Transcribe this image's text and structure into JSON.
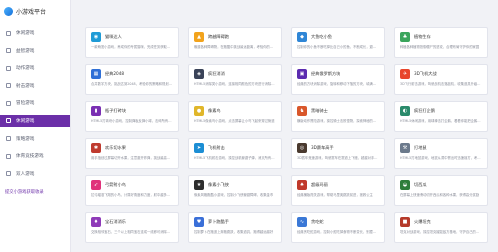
{
  "app": {
    "title": "小游戏平台"
  },
  "sidebar": {
    "items": [
      {
        "label": "休闲游戏",
        "icon": "gamepad-icon",
        "active": false
      },
      {
        "label": "益智游戏",
        "icon": "puzzle-icon",
        "active": false
      },
      {
        "label": "动作游戏",
        "icon": "action-icon",
        "active": false
      },
      {
        "label": "射击游戏",
        "icon": "target-icon",
        "active": false
      },
      {
        "label": "冒险游戏",
        "icon": "compass-icon",
        "active": false
      },
      {
        "label": "休闲游戏",
        "icon": "gamepad-icon",
        "active": true
      },
      {
        "label": "策略游戏",
        "icon": "strategy-icon",
        "active": false
      },
      {
        "label": "体育竞技游戏",
        "icon": "trophy-icon",
        "active": false
      },
      {
        "label": "双人游戏",
        "icon": "users-icon",
        "active": false
      }
    ],
    "footer_link": "提交小游戏获取收录"
  },
  "games": [
    {
      "name": "猫咪达人",
      "desc": "一款萌宠小游戏，养成你的专属猫咪，完成任务获取奖励",
      "color": "#1f9bd6",
      "icon": "cat-icon",
      "glyph": "◉"
    },
    {
      "name": "跨越障碍跑",
      "desc": "躲避各种障碍物，在跑酷中挑战最远距离，考验你的反应速度",
      "color": "#f2a31c",
      "icon": "runner-icon",
      "glyph": "▲"
    },
    {
      "name": "大鱼吃小鱼",
      "desc": "控制你的小鱼不断吃掉比自己小的鱼，不断成长，避开大鱼",
      "color": "#2f86d6",
      "icon": "fish-icon",
      "glyph": "◆"
    },
    {
      "name": "植物生存",
      "desc": "种植各种植物抵御僵尸的进攻，合理布局守护你的家园",
      "color": "#3aa55c",
      "icon": "plant-icon",
      "glyph": "♣"
    },
    {
      "name": "经典2048",
      "desc": "合并数字方块，挑战达到2048，考验你的策略和规划能力",
      "color": "#2f6fd6",
      "icon": "tiles-icon",
      "glyph": "▦"
    },
    {
      "name": "疯狂消消",
      "desc": "HTML5消除类小游戏，连接相同颜色的方块进行消除得分",
      "color": "#3a4358",
      "icon": "gem-icon",
      "glyph": "◈"
    },
    {
      "name": "经典俄罗斯方块",
      "desc": "经典的方块消除游戏，旋转和移动下落的方块，填满整行消除",
      "color": "#5b2bb0",
      "icon": "blocks-icon",
      "glyph": "▣"
    },
    {
      "name": "3D飞机大战",
      "desc": "3D飞行射击游戏，驾驶战机击落敌机，收集道具升级武器",
      "color": "#e8452c",
      "icon": "plane-icon",
      "glyph": "✈"
    },
    {
      "name": "瓶子打砖块",
      "desc": "HTML5打砖块小游戏，控制弹板反弹小球，击碎所有砖块过关",
      "color": "#7a2fb3",
      "icon": "bottle-icon",
      "glyph": "▮"
    },
    {
      "name": "像素鸟",
      "desc": "HTML5像素鸟小游戏，点击屏幕让小鸟飞起来穿过管道",
      "color": "#e0b62a",
      "icon": "bird-icon",
      "glyph": "●"
    },
    {
      "name": "黑暗骑士",
      "desc": "横版动作冒险游戏，操控骑士击败怪物，探索神秘的城堡",
      "color": "#d9572b",
      "icon": "knight-icon",
      "glyph": "♞"
    },
    {
      "name": "疯狂打企鹅",
      "desc": "HTML5休闲游戏，用球棒击打企鹅，看看你能把企鹅打多远",
      "color": "#2a8a6b",
      "icon": "penguin-icon",
      "glyph": "◐"
    },
    {
      "name": "欢乐切水果",
      "desc": "用手指划过屏幕切开水果，注意避开炸弹，挑战最高连击分数",
      "color": "#bf3b2f",
      "icon": "fruit-icon",
      "glyph": "✱"
    },
    {
      "name": "飞机射击",
      "desc": "HTML5飞机射击游戏，操控战机躲避子弹，消灭所有敌机",
      "color": "#1c8ed4",
      "icon": "jet-icon",
      "glyph": "➤"
    },
    {
      "name": "3D赛车高手",
      "desc": "3D赛车竞速游戏，驾驶赛车在赛道上飞驰，超越对手夺冠",
      "color": "#4a3a2f",
      "icon": "car-icon",
      "glyph": "◎"
    },
    {
      "name": "打地鼠",
      "desc": "HTML5打地鼠游戏，地鼠从洞中冒出时迅速敲打，考验手速",
      "color": "#6c7a8c",
      "icon": "hammer-icon",
      "glyph": "⚒"
    },
    {
      "name": "弓箭射小鸟",
      "desc": "拉弓瞄准飞翔的小鸟，计算好角度和力度，射中越多得分越高",
      "color": "#e0327a",
      "icon": "bow-icon",
      "glyph": "➶"
    },
    {
      "name": "像素小飞侠",
      "desc": "像素风格跑酷小游戏，控制小飞侠躲避障碍，收集金币",
      "color": "#2d2d2d",
      "icon": "hero-icon",
      "glyph": "★"
    },
    {
      "name": "超级玛丽",
      "desc": "经典横版闯关游戏，帮助马里奥跳跃前进，拯救公主",
      "color": "#c0392b",
      "icon": "mushroom-icon",
      "glyph": "♠"
    },
    {
      "name": "切西瓜",
      "desc": "在屏幕上快速滑动切开西瓜和各种水果，获得高分奖励",
      "color": "#2e7d3a",
      "icon": "melon-icon",
      "glyph": "◒"
    },
    {
      "name": "宝石消消乐",
      "desc": "交换相邻宝石，三个以上相同宝石连成一线即可消除得分",
      "color": "#8e3ab8",
      "icon": "jewel-icon",
      "glyph": "♦"
    },
    {
      "name": "萝卜跑酷手",
      "desc": "控制萝卜在跑道上奔跑跳跃，收集道具，跑得越远越好",
      "color": "#3a6fd8",
      "icon": "carrot-icon",
      "glyph": "♥"
    },
    {
      "name": "贪吃蛇",
      "desc": "经典贪吃蛇游戏，控制小蛇吃掉食物不断变长，别撞到自己",
      "color": "#3a78d6",
      "icon": "snake-icon",
      "glyph": "∿"
    },
    {
      "name": "火爆坦克",
      "desc": "坦克对战游戏，操控坦克摧毁敌方基地，守护自己的阵地",
      "color": "#b53a2a",
      "icon": "tank-icon",
      "glyph": "■"
    }
  ]
}
